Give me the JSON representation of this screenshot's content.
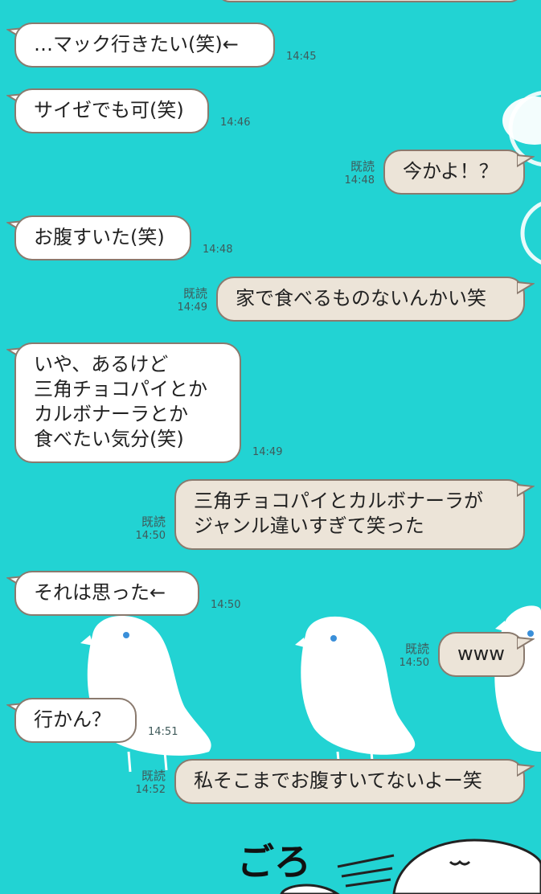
{
  "colors": {
    "background": "#22d3d3",
    "received_bubble": "#ffffff",
    "sent_bubble": "#ece4d8",
    "bubble_border": "#8a7a6e"
  },
  "messages": [
    {
      "side": "received",
      "text": "…マック行きたい(笑)←",
      "time": "14:45"
    },
    {
      "side": "received",
      "text": "サイゼでも可(笑)",
      "time": "14:46"
    },
    {
      "side": "sent",
      "text": "今かよ！？",
      "read": "既読",
      "time": "14:48"
    },
    {
      "side": "received",
      "text": "お腹すいた(笑)",
      "time": "14:48"
    },
    {
      "side": "sent",
      "text": "家で食べるものないんかい笑",
      "read": "既読",
      "time": "14:49"
    },
    {
      "side": "received",
      "text": "いや、あるけど\n三角チョコパイとか\nカルボナーラとか\n食べたい気分(笑)",
      "time": "14:49"
    },
    {
      "side": "sent",
      "text": "三角チョコパイとカルボナーラが\nジャンル違いすぎて笑った",
      "read": "既読",
      "time": "14:50"
    },
    {
      "side": "received",
      "text": "それは思った←",
      "time": "14:50"
    },
    {
      "side": "sent",
      "text": "www",
      "read": "既読",
      "time": "14:50"
    },
    {
      "side": "received",
      "text": "行かん？",
      "time": "14:51"
    },
    {
      "side": "sent",
      "text": "私そこまでお腹すいてないよー笑",
      "read": "既読",
      "time": "14:52"
    }
  ],
  "background_deco": {
    "description_icons": [
      "bird-illustration",
      "flower-outline",
      "round-face-illustration"
    ],
    "handwritten_text": "ごろ"
  }
}
